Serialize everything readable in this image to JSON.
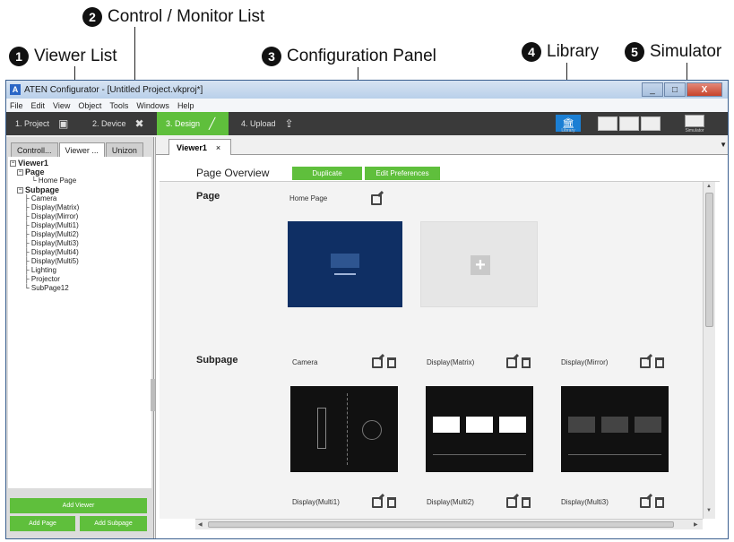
{
  "callouts": {
    "c1": {
      "num": "1",
      "label": "Viewer List"
    },
    "c2": {
      "num": "2",
      "label": "Control / Monitor List"
    },
    "c3": {
      "num": "3",
      "label": "Configuration Panel"
    },
    "c4": {
      "num": "4",
      "label": "Library"
    },
    "c5": {
      "num": "5",
      "label": "Simulator"
    }
  },
  "window": {
    "title": "ATEN Configurator - [Untitled Project.vkproj*]",
    "app_icon": "A",
    "minimize": "_",
    "maximize": "□",
    "close": "X"
  },
  "menu": [
    "File",
    "Edit",
    "View",
    "Object",
    "Tools",
    "Windows",
    "Help"
  ],
  "steps": [
    {
      "label": "1. Project",
      "icon": "save-icon"
    },
    {
      "label": "2. Device",
      "icon": "wrench-icon"
    },
    {
      "label": "3. Design",
      "icon": "brush-icon"
    },
    {
      "label": "4. Upload",
      "icon": "upload-icon"
    }
  ],
  "toolbar": {
    "library_label": "Library",
    "simulator_label": "Simulator",
    "library_glyph": "🏛"
  },
  "left_tabs": [
    "Controll...",
    "Viewer ...",
    "Unizon"
  ],
  "tree": {
    "root": "Viewer1",
    "page_group": "Page",
    "pages": [
      "Home Page"
    ],
    "subpage_group": "Subpage",
    "subpages": [
      "Camera",
      "Display(Matrix)",
      "Display(Mirror)",
      "Display(Multi1)",
      "Display(Multi2)",
      "Display(Multi3)",
      "Display(Multi4)",
      "Display(Multi5)",
      "Lighting",
      "Projector",
      "SubPage12"
    ]
  },
  "left_buttons": {
    "add_viewer": "Add Viewer",
    "add_page": "Add Page",
    "add_subpage": "Add Subpage"
  },
  "doc_tab": {
    "label": "Viewer1",
    "close": "×"
  },
  "overview": {
    "title": "Page Overview",
    "duplicate": "Duplicate",
    "edit_prefs": "Edit Preferences"
  },
  "page_section": {
    "title": "Page",
    "cards": [
      {
        "label": "Home Page"
      }
    ],
    "add_glyph": "+"
  },
  "subpage_section": {
    "title": "Subpage",
    "cards": [
      "Camera",
      "Display(Matrix)",
      "Display(Mirror)",
      "Display(Multi1)",
      "Display(Multi2)",
      "Display(Multi3)"
    ]
  },
  "colors": {
    "accent_green": "#5fbf3c",
    "library_blue": "#1b7fd4",
    "thumb_navy": "#0f2f64"
  }
}
